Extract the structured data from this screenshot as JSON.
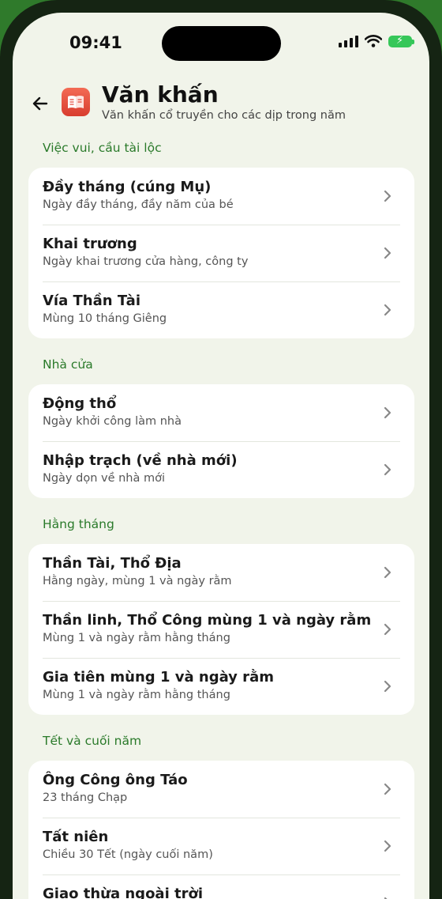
{
  "status": {
    "time": "09:41"
  },
  "header": {
    "title": "Văn khấn",
    "subtitle": "Văn khấn cổ truyền cho các dịp trong năm"
  },
  "sections": [
    {
      "title": "Việc vui, cầu tài lộc",
      "items": [
        {
          "title": "Đầy tháng (cúng Mụ)",
          "subtitle": "Ngày đầy tháng, đầy năm của bé"
        },
        {
          "title": "Khai trương",
          "subtitle": "Ngày khai trương cửa hàng, công ty"
        },
        {
          "title": "Vía Thần Tài",
          "subtitle": "Mùng 10 tháng Giêng"
        }
      ]
    },
    {
      "title": "Nhà cửa",
      "items": [
        {
          "title": "Động thổ",
          "subtitle": "Ngày khởi công làm nhà"
        },
        {
          "title": "Nhập trạch (về nhà mới)",
          "subtitle": "Ngày dọn về nhà mới"
        }
      ]
    },
    {
      "title": "Hằng tháng",
      "items": [
        {
          "title": "Thần Tài, Thổ Địa",
          "subtitle": "Hằng ngày, mùng 1 và ngày rằm"
        },
        {
          "title": "Thần linh, Thổ Công mùng 1 và ngày rằm",
          "subtitle": "Mùng 1 và ngày rằm hằng tháng"
        },
        {
          "title": "Gia tiên mùng 1 và ngày rằm",
          "subtitle": "Mùng 1 và ngày rằm hằng tháng"
        }
      ]
    },
    {
      "title": "Tết và cuối năm",
      "items": [
        {
          "title": "Ông Công ông Táo",
          "subtitle": "23 tháng Chạp"
        },
        {
          "title": "Tất niên",
          "subtitle": "Chiều 30 Tết (ngày cuối năm)"
        },
        {
          "title": "Giao thừa ngoài trời",
          "subtitle": ""
        }
      ]
    }
  ],
  "icons": {
    "back": "arrow-left-icon",
    "app": "book-icon",
    "chevron": "chevron-right-icon"
  },
  "colors": {
    "accent": "#2a7a2a",
    "app_icon": "#e4483a",
    "background": "#f1f4ea"
  }
}
